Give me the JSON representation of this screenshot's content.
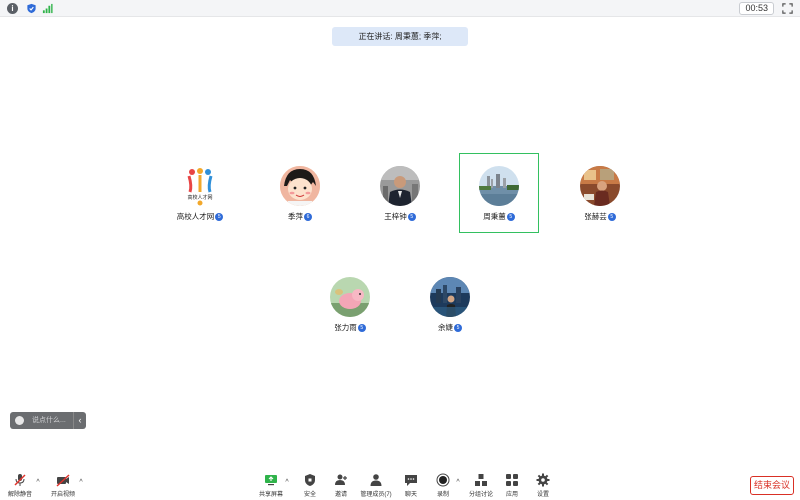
{
  "topbar": {
    "timer": "00:53"
  },
  "banner": {
    "speaking": "正在讲话: 周秉蕙; 季萍;"
  },
  "participants": [
    {
      "name": "高校人才网",
      "badge": "5"
    },
    {
      "name": "季萍",
      "badge": "6"
    },
    {
      "name": "王梓钟",
      "badge": "5"
    },
    {
      "name": "周秉蕙",
      "badge": "5"
    },
    {
      "name": "张赫芸",
      "badge": "5"
    },
    {
      "name": "张力雨",
      "badge": "5"
    },
    {
      "name": "余婕",
      "badge": "5"
    }
  ],
  "logo": {
    "text": "高校人才网"
  },
  "chat": {
    "placeholder": "说点什么..."
  },
  "toolbar": {
    "unmute": "解除静音",
    "video": "开启视频",
    "share": "共享屏幕",
    "security": "安全",
    "invite": "邀请",
    "participants": "管理成员(7)",
    "chat": "聊天",
    "record": "录制",
    "breakout": "分组讨论",
    "apps": "应用",
    "settings": "设置",
    "end": "结束会议"
  },
  "colors": {
    "accent": "#2f6bd8",
    "active_border": "#33c060",
    "end": "#d93025",
    "banner": "#dde8f8"
  }
}
